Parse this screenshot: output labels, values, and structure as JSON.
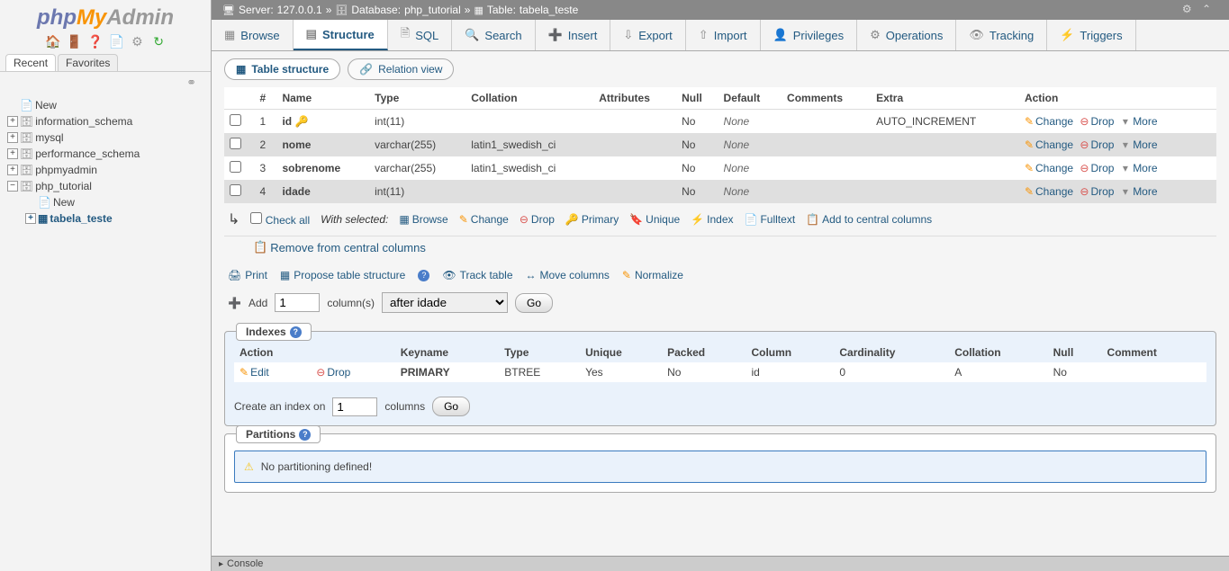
{
  "logo": {
    "p1": "php",
    "p2": "My",
    "p3": "Admin"
  },
  "sidebar": {
    "tabs": {
      "recent": "Recent",
      "favorites": "Favorites"
    },
    "new": "New",
    "databases": [
      "information_schema",
      "mysql",
      "performance_schema",
      "phpmyadmin",
      "php_tutorial"
    ],
    "tutorial_children": {
      "new": "New",
      "table": "tabela_teste"
    }
  },
  "breadcrumb": {
    "server_lbl": "Server:",
    "server": "127.0.0.1",
    "db_lbl": "Database:",
    "db": "php_tutorial",
    "table_lbl": "Table:",
    "table": "tabela_teste",
    "sep": "»"
  },
  "tabs": [
    "Browse",
    "Structure",
    "SQL",
    "Search",
    "Insert",
    "Export",
    "Import",
    "Privileges",
    "Operations",
    "Tracking",
    "Triggers"
  ],
  "active_tab": 1,
  "subtabs": {
    "table_structure": "Table structure",
    "relation_view": "Relation view"
  },
  "columns_header": {
    "num": "#",
    "name": "Name",
    "type": "Type",
    "collation": "Collation",
    "attributes": "Attributes",
    "null": "Null",
    "default": "Default",
    "comments": "Comments",
    "extra": "Extra",
    "action": "Action"
  },
  "columns": [
    {
      "num": "1",
      "name": "id",
      "key": true,
      "type": "int(11)",
      "collation": "",
      "null": "No",
      "default": "None",
      "extra": "AUTO_INCREMENT"
    },
    {
      "num": "2",
      "name": "nome",
      "key": false,
      "type": "varchar(255)",
      "collation": "latin1_swedish_ci",
      "null": "No",
      "default": "None",
      "extra": ""
    },
    {
      "num": "3",
      "name": "sobrenome",
      "key": false,
      "type": "varchar(255)",
      "collation": "latin1_swedish_ci",
      "null": "No",
      "default": "None",
      "extra": ""
    },
    {
      "num": "4",
      "name": "idade",
      "key": false,
      "type": "int(11)",
      "collation": "",
      "null": "No",
      "default": "None",
      "extra": ""
    }
  ],
  "actions": {
    "change": "Change",
    "drop": "Drop",
    "more": "More"
  },
  "bulk": {
    "check_all": "Check all",
    "with_selected": "With selected:",
    "browse": "Browse",
    "change": "Change",
    "drop": "Drop",
    "primary": "Primary",
    "unique": "Unique",
    "index": "Index",
    "fulltext": "Fulltext",
    "add_central": "Add to central columns",
    "remove_central": "Remove from central columns"
  },
  "ops": {
    "print": "Print",
    "propose": "Propose table structure",
    "track": "Track table",
    "move": "Move columns",
    "normalize": "Normalize"
  },
  "add": {
    "label": "Add",
    "count": "1",
    "columns": "column(s)",
    "position": "after idade",
    "go": "Go"
  },
  "indexes": {
    "title": "Indexes",
    "header": {
      "action": "Action",
      "keyname": "Keyname",
      "type": "Type",
      "unique": "Unique",
      "packed": "Packed",
      "column": "Column",
      "cardinality": "Cardinality",
      "collation": "Collation",
      "null": "Null",
      "comment": "Comment"
    },
    "rows": [
      {
        "edit": "Edit",
        "drop": "Drop",
        "keyname": "PRIMARY",
        "type": "BTREE",
        "unique": "Yes",
        "packed": "No",
        "column": "id",
        "cardinality": "0",
        "collation": "A",
        "null": "No",
        "comment": ""
      }
    ],
    "create": {
      "pre": "Create an index on",
      "count": "1",
      "post": "columns",
      "go": "Go"
    }
  },
  "partitions": {
    "title": "Partitions",
    "msg": "No partitioning defined!"
  },
  "console": "Console"
}
